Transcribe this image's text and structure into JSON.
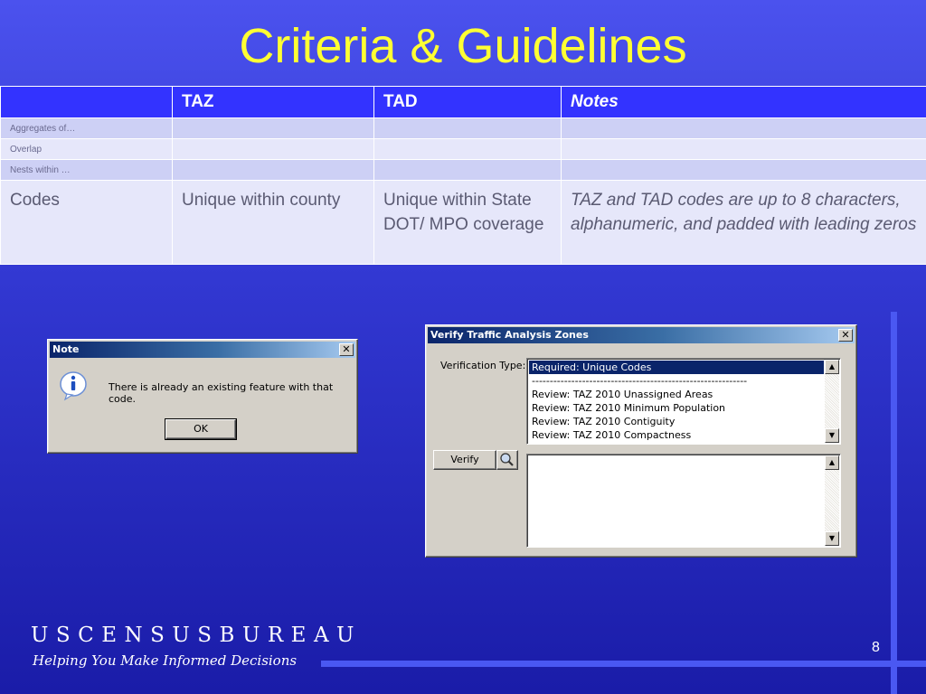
{
  "slide": {
    "title": "Criteria & Guidelines",
    "page_number": "8"
  },
  "table": {
    "headers": [
      "",
      "TAZ",
      "TAD",
      "Notes"
    ],
    "rows": [
      {
        "label": "Aggregates of…",
        "taz": "",
        "tad": "",
        "notes": ""
      },
      {
        "label": "Overlap",
        "taz": "",
        "tad": "",
        "notes": ""
      },
      {
        "label": "Nests within …",
        "taz": "",
        "tad": "",
        "notes": ""
      },
      {
        "label": "Codes",
        "taz": "Unique within county",
        "tad": "Unique within State DOT/ MPO coverage",
        "notes": "TAZ and TAD codes are up to 8 characters, alphanumeric, and padded with leading zeros"
      }
    ]
  },
  "note_dialog": {
    "title": "Note",
    "close_glyph": "✕",
    "message": "There is already an existing feature with that code.",
    "ok_label": "OK",
    "icon": "info-icon"
  },
  "verify_dialog": {
    "title": "Verify Traffic Analysis Zones",
    "close_glyph": "✕",
    "verification_type_label": "Verification Type:",
    "options": [
      "Required: Unique Codes",
      "------------------------------------------------------------",
      "Review: TAZ 2010 Unassigned Areas",
      "Review: TAZ 2010 Minimum Population",
      "Review: TAZ 2010 Contiguity",
      "Review: TAZ 2010 Compactness"
    ],
    "selected_option": "Required: Unique Codes",
    "verify_label": "Verify",
    "output_text": ""
  },
  "footer": {
    "logo_text": "USCENSUSBUREAU",
    "tagline": "Helping You Make Informed Decisions"
  },
  "colors": {
    "title_yellow": "#ffff33",
    "header_blue": "#3333ff",
    "row_light": "#cdd0f5",
    "row_lighter": "#e6e7fa",
    "selection_navy": "#0a246a"
  }
}
